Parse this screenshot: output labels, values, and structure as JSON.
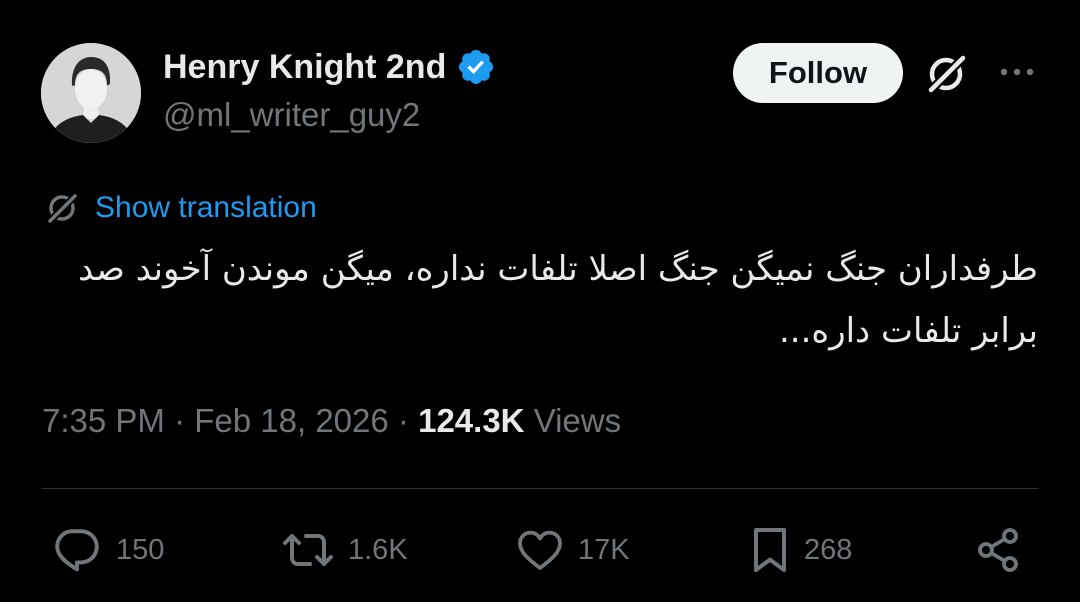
{
  "author": {
    "display_name": "Henry Knight 2nd",
    "handle": "@ml_writer_guy2",
    "verified": true
  },
  "header": {
    "follow_label": "Follow",
    "grok_icon": "grok-icon",
    "more_icon": "more-icon"
  },
  "translation": {
    "link_label": "Show translation",
    "icon": "translate-icon"
  },
  "tweet": {
    "text": "طرفداران جنگ نمیگن جنگ اصلا تلفات نداره، میگن موندن آخوند صد برابر تلفات داره..."
  },
  "meta": {
    "time": "7:35 PM",
    "separator": "·",
    "date": "Feb 18, 2026",
    "views_count": "124.3K",
    "views_label": "Views"
  },
  "actions": {
    "replies": "150",
    "reposts": "1.6K",
    "likes": "17K",
    "bookmarks": "268"
  },
  "colors": {
    "background": "#000000",
    "primary_text": "#e7e9ea",
    "secondary_text": "#71767b",
    "accent": "#1d9bf0",
    "divider": "#2f3336",
    "follow_bg": "#eff3f4"
  }
}
